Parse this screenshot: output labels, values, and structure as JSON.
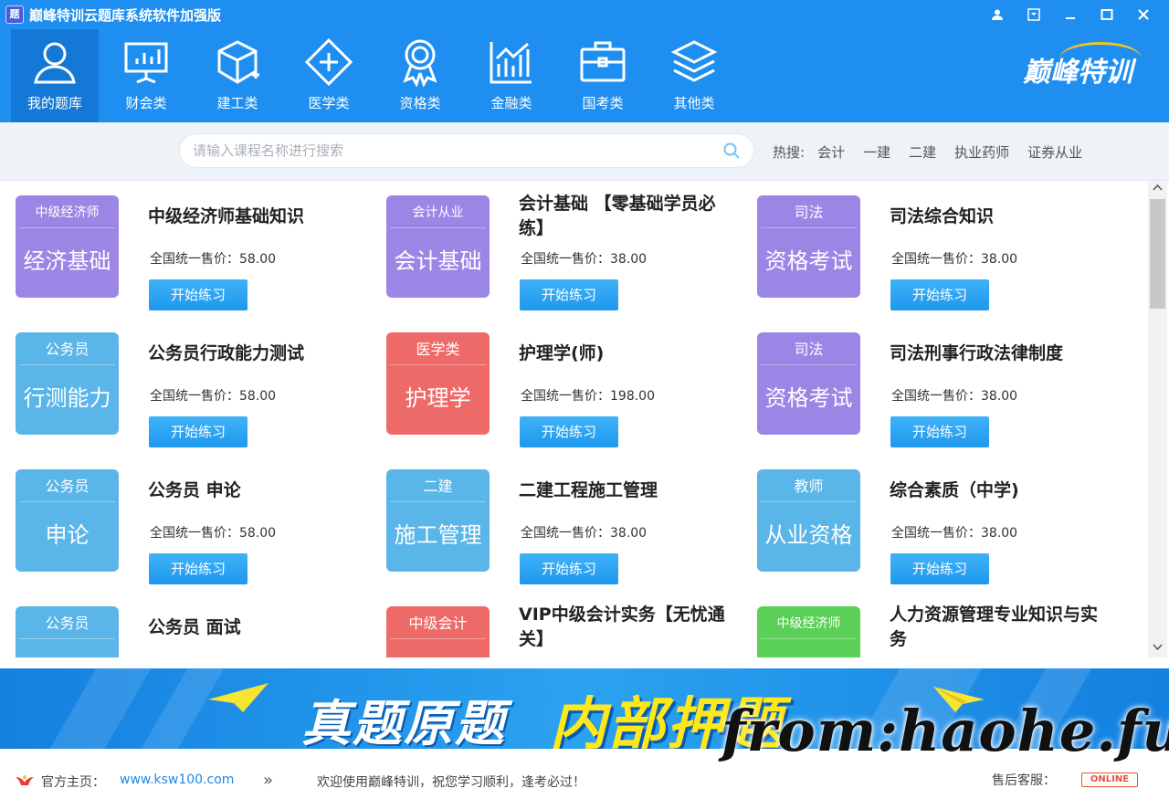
{
  "window": {
    "title": "巅峰特训云题库系统软件加强版",
    "app_icon": "题"
  },
  "nav": {
    "items": [
      {
        "label": "我的题库",
        "icon": "user-icon"
      },
      {
        "label": "财会类",
        "icon": "presentation-board-icon"
      },
      {
        "label": "建工类",
        "icon": "cube-icon"
      },
      {
        "label": "医学类",
        "icon": "medical-cross-icon"
      },
      {
        "label": "资格类",
        "icon": "award-ribbon-icon"
      },
      {
        "label": "金融类",
        "icon": "bar-chart-icon"
      },
      {
        "label": "国考类",
        "icon": "briefcase-icon"
      },
      {
        "label": "其他类",
        "icon": "layers-icon"
      }
    ],
    "active_index": 0,
    "logo_text": "巅峰特训"
  },
  "search": {
    "placeholder": "请输入课程名称进行搜索",
    "hot_label": "热搜:",
    "hot_terms": [
      "会计",
      "一建",
      "二建",
      "执业药师",
      "证券从业"
    ]
  },
  "courses": [
    {
      "thumb_top": "中级经济师",
      "thumb_main": "经济基础",
      "color": "#9b86e6",
      "title": "中级经济师基础知识",
      "price": "全国统一售价：58.00",
      "button": "开始练习"
    },
    {
      "thumb_top": "会计从业",
      "thumb_main": "会计基础",
      "color": "#9b86e6",
      "title": "会计基础 【零基础学员必练】",
      "price": "全国统一售价：38.00",
      "button": "开始练习"
    },
    {
      "thumb_top": "司法",
      "thumb_main": "资格考试",
      "color": "#9b86e6",
      "title": "司法综合知识",
      "price": "全国统一售价：38.00",
      "button": "开始练习"
    },
    {
      "thumb_top": "公务员",
      "thumb_main": "行测能力",
      "color": "#5ab5e8",
      "title": "公务员行政能力测试",
      "price": "全国统一售价：58.00",
      "button": "开始练习"
    },
    {
      "thumb_top": "医学类",
      "thumb_main": "护理学",
      "color": "#ee6a68",
      "title": "护理学(师)",
      "price": "全国统一售价：198.00",
      "button": "开始练习"
    },
    {
      "thumb_top": "司法",
      "thumb_main": "资格考试",
      "color": "#9b86e6",
      "title": "司法刑事行政法律制度",
      "price": "全国统一售价：38.00",
      "button": "开始练习"
    },
    {
      "thumb_top": "公务员",
      "thumb_main": "申论",
      "color": "#5ab5e8",
      "title": "公务员 申论",
      "price": "全国统一售价：58.00",
      "button": "开始练习"
    },
    {
      "thumb_top": "二建",
      "thumb_main": "施工管理",
      "color": "#5ab5e8",
      "title": "二建工程施工管理",
      "price": "全国统一售价：38.00",
      "button": "开始练习"
    },
    {
      "thumb_top": "教师",
      "thumb_main": "从业资格",
      "color": "#5ab5e8",
      "title": "综合素质（中学)",
      "price": "全国统一售价：38.00",
      "button": "开始练习"
    },
    {
      "thumb_top": "公务员",
      "thumb_main": "",
      "color": "#5ab5e8",
      "title": "公务员 面试",
      "price": "",
      "button": ""
    },
    {
      "thumb_top": "中级会计",
      "thumb_main": "",
      "color": "#ee6a68",
      "title": "VIP中级会计实务【无忧通关】",
      "price": "",
      "button": ""
    },
    {
      "thumb_top": "中级经济师",
      "thumb_main": "",
      "color": "#5ad056",
      "title": "人力资源管理专业知识与实务",
      "price": "",
      "button": ""
    }
  ],
  "banner": {
    "text_white": "真题原题",
    "text_yellow": "内部押题"
  },
  "watermark": "from:haohe.fun",
  "footer": {
    "home_label": "官方主页：",
    "home_link": "www.ksw100.com",
    "welcome": "欢迎使用巅峰特训，祝您学习顺利，逢考必过！",
    "service_label": "售后客服：",
    "online_badge": "ONLINE"
  }
}
